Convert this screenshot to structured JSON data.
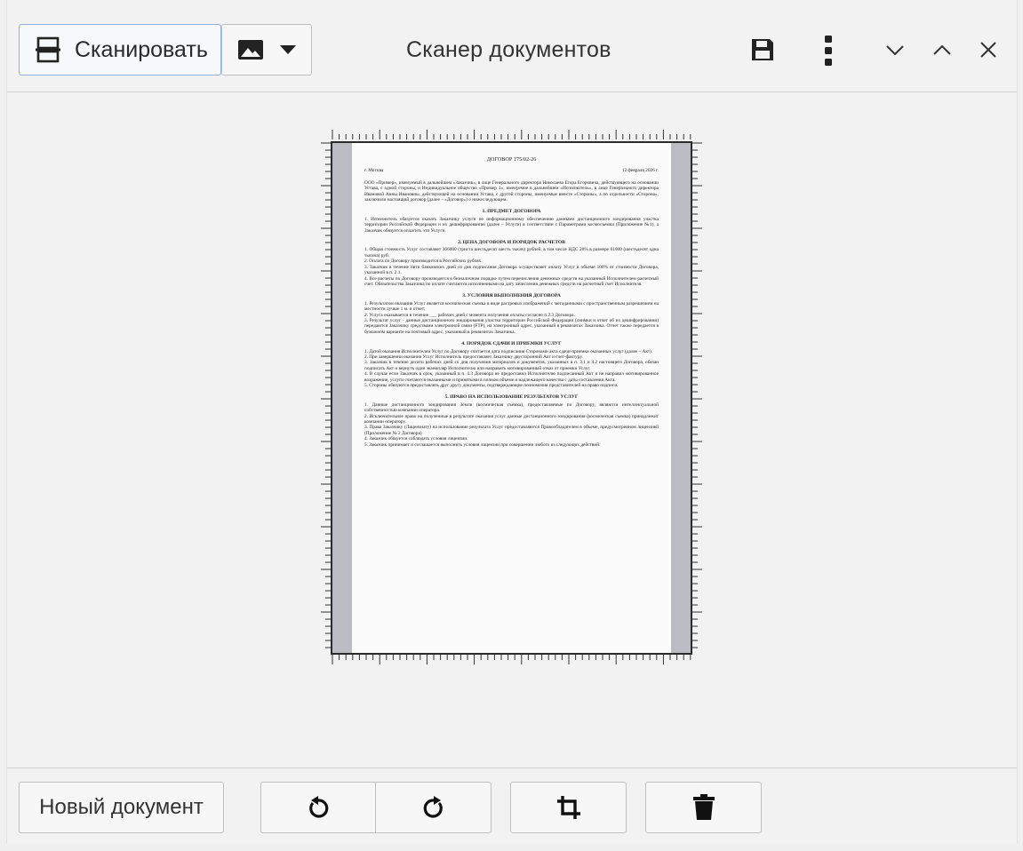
{
  "app": {
    "title": "Сканер документов"
  },
  "toolbar": {
    "scan_label": "Сканировать",
    "scan_icon": "scanner-icon",
    "image_mode_icon": "image-icon",
    "dropdown_icon": "caret-down-icon",
    "save_icon": "save-icon",
    "menu_icon": "kebab-menu-icon",
    "minimize_icon": "chevron-down-icon",
    "maximize_icon": "chevron-up-icon",
    "close_icon": "close-icon"
  },
  "bottom": {
    "new_document_label": "Новый документ",
    "rotate_left_icon": "rotate-left-icon",
    "rotate_right_icon": "rotate-right-icon",
    "crop_icon": "crop-icon",
    "delete_icon": "trash-icon"
  },
  "document": {
    "title": "ДОГОВОР 175/02-26",
    "city": "г. Москва",
    "date": "12 февраля 2026 г.",
    "intro": "ООО «Пример», именуемый в дальнейшем «Заказчик», в лице Генерального директора Николаева Егора Егоровича, действующего на основании Устава, с одной стороны, и Индивидуальное общество «Пример 1», именуемое в дальнейшем «Исполнитель», в лице Генерального директора Ивановой Анны Ивановны, действующей на основании Устава, с другой стороны, именуемые вместе «Стороны», а по отдельности «Сторона», заключили настоящий договор (далее – «Договор») о нижеследующем.",
    "sections": [
      {
        "heading": "1. ПРЕДМЕТ ДОГОВОРА",
        "items": [
          "1.       Исполнитель обязуется оказать Заказчику услуги по информационному обеспечению данными дистанционного зондирования участка территории Российской Федерации и их дешифрированию (далее – Услуги) в соответствии с Параметрами космосъемки (Приложение №1), а Заказчик обязуется оплатить эти Услуги."
        ]
      },
      {
        "heading": "2. ЦЕНА ДОГОВОРА И ПОРЯДОК РАСЧЕТОВ",
        "items": [
          "1.   Общая стоимость Услуг составляет 366000 (триста шестьдесят шесть тысяч) рублей, в том числе НДС 20% в размере 61000 (шестьдесят одна тысяча) руб.",
          "2.   Оплата по Договору производится в Российских рублях.",
          "3.   Заказчик в течение пяти банковских дней со дня подписания Договора осуществляет оплату Услуг в объеме 100% от стоимости Договора, указанной в п. 2.1.",
          "4.   Все расчеты по Договору производятся в безналичном порядке путем перечисления денежных средств на указанный Исполнителем расчетный счет. Обязательства Заказчика по оплате считаются исполненными на дату зачисления денежных средств на расчетный счет Исполнителя."
        ]
      },
      {
        "heading": "3. УСЛОВИЯ ВЫПОЛНЕНИЯ ДОГОВОРА",
        "items": [
          "1.   Результатом оказания Услуг является космическая съемка в виде растровых изображений с метаданными с пространственным разрешением на местности лучше 1 м. и отчет;",
          "2.   Услуга оказывается в течение ___ рабочих дней с момента получения оплаты согласно п.2.3 Договора.",
          "3.   Результат услуг - данные дистанционного зондирования участка территории Российской Федерации (снимки и отчет об их дешифрировании) передаются Заказчику средствами электронной связи (FTP), на электронный адрес, указанный в реквизитах Заказчика. Отчет также передается в бумажном варианте на почтовый адрес, указанный в реквизитах Заказчика."
        ]
      },
      {
        "heading": "4. ПОРЯДОК СДАЧИ И ПРИЕМКИ УСЛУГ",
        "items": [
          "1.   Датой оказания Исполнителем Услуг по Договору считается дата подписания Сторонами акта сдачи-приемки оказанных услуг (далее – Акт).",
          "2.   При завершении оказания Услуг Исполнитель предоставляет Заказчику двусторонний Акт и счет-фактуру.",
          "3.   Заказчик в течение десяти рабочих дней со дня получения материалов и документов, указанных в п. 3.1 и 4.2 настоящего Договора, обязан подписать Акт и вернуть один экземпляр Исполнителю или направить мотивированный отказ от приемки Услуг.",
          "4.   В случае если Заказчик в срок, указанный в п. 4.3 Договора не предоставил Исполнителю подписанный Акт и не направил мотивированное возражение, услуги считаются оказанными и принятыми в полном объеме и надлежащего качества с даты составления Акта.",
          "5.   Стороны обязуются предоставлять друг другу документы, подтверждающие полномочия представителей на право подписи."
        ]
      },
      {
        "heading": "5. ПРАВО НА ИСПОЛЬЗОВАНИЕ РЕЗУЛЬТАТОВ УСЛУГ",
        "items": [
          "1.        Данные дистанционного зондирования Земли (космическая съемка), предоставляемые по Договору, являются интеллектуальной собственностью компании оператора.",
          "2.        Исключительное право на полученные в результате оказания услуг данные дистанционного зондирования (космическая съемка) принадлежит компании оператору.",
          "3.        Права Заказчику (Лицензиату) на использование результата Услуг предоставляются Правообладателем в объеме, предусмотренном лицензией (Приложение № 2 Договора)",
          "4.        Заказчик обязуется соблюдать условия лицензии.",
          "5.        Заказчик принимает и соглашается выполнить условия лицензии при совершении любого из следующих действий:"
        ]
      }
    ]
  }
}
